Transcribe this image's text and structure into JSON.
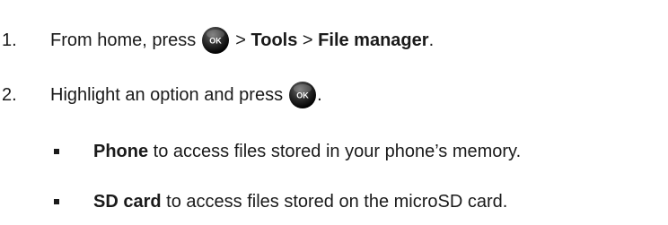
{
  "steps": [
    {
      "number": "1.",
      "before_icon": "From home, press",
      "icon": "ok-button-icon",
      "after_icon_prefix": " > ",
      "bold_1": "Tools",
      "separator": " > ",
      "bold_2": "File manager",
      "end": "."
    },
    {
      "number": "2.",
      "before_icon": "Highlight an option and press",
      "icon": "ok-button-icon",
      "end": "."
    }
  ],
  "bullets": [
    {
      "bold": "Phone",
      "text": " to access files stored in your phone’s memory."
    },
    {
      "bold": "SD card",
      "text": " to access files stored on the microSD card."
    }
  ],
  "ok_label": "OK"
}
